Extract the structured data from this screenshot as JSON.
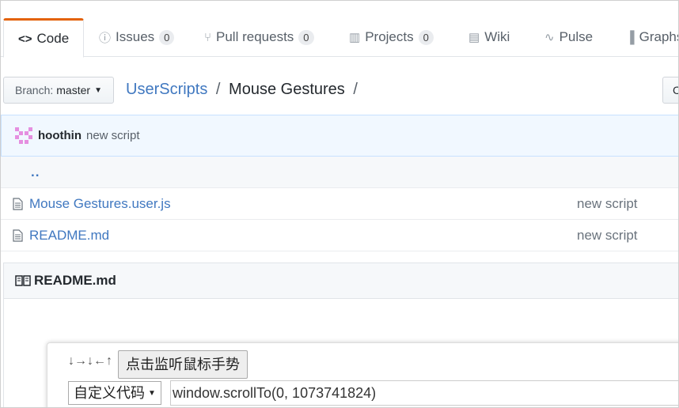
{
  "tabs": [
    {
      "label": "Code",
      "icon": "code-icon"
    },
    {
      "label": "Issues",
      "count": "0",
      "icon": "issue-icon"
    },
    {
      "label": "Pull requests",
      "count": "0",
      "icon": "pull-request-icon"
    },
    {
      "label": "Projects",
      "count": "0",
      "icon": "project-icon"
    },
    {
      "label": "Wiki",
      "icon": "book-icon"
    },
    {
      "label": "Pulse",
      "icon": "pulse-icon"
    },
    {
      "label": "Graphs",
      "icon": "graph-icon"
    }
  ],
  "branch": {
    "prefix": "Branch:",
    "name": "master"
  },
  "breadcrumb": {
    "repo": "UserScripts",
    "folder": "Mouse Gestures",
    "sep": "/"
  },
  "right_button": "C",
  "commit": {
    "author": "hoothin",
    "message": "new script"
  },
  "up_dir": "..",
  "files": [
    {
      "name": "Mouse Gestures.user.js",
      "message": "new script"
    },
    {
      "name": "README.md",
      "message": "new script"
    }
  ],
  "readme": {
    "title": "README.md"
  },
  "gesture_panel": {
    "arrows": "↓→↓←↑",
    "listen_button": "点击监听鼠标手势",
    "select_value": "自定义代码",
    "code_value": "window.scrollTo(0, 1073741824)"
  },
  "colors": {
    "accent": "#e36209",
    "link": "#4078c0",
    "commit_bg": "#f1f8ff"
  }
}
